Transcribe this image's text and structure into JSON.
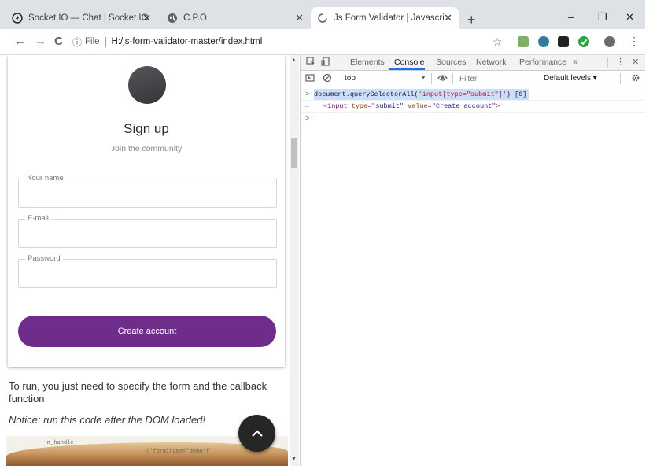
{
  "browser": {
    "tabs": [
      {
        "title": "Socket.IO — Chat | Socket.IO"
      },
      {
        "title": "C.P.O"
      },
      {
        "title": "Js Form Validator | Javascript vali"
      }
    ],
    "new_tab": "+",
    "window_controls": {
      "minimize": "–",
      "restore": "❐",
      "close": "✕"
    },
    "nav": {
      "back": "←",
      "forward": "→",
      "reload": "C"
    },
    "address": {
      "info": "ⓘ",
      "scheme": "File",
      "url": "H:/js-form-validator-master/index.html"
    }
  },
  "page": {
    "card": {
      "title": "Sign up",
      "subtitle": "Join the community",
      "fields": [
        {
          "label": "Your name"
        },
        {
          "label": "E-mail"
        },
        {
          "label": "Password"
        }
      ],
      "button": "Create account"
    },
    "run_text": "To run, you just need to specify the form and the callback function",
    "notice": "Notice: run this code after the DOM loaded!",
    "code_snips": [
      "m_handle",
      "('form[name=\"demo-f"
    ],
    "fab": "⌃"
  },
  "devtools": {
    "tabs": [
      "Elements",
      "Console",
      "Sources",
      "Network",
      "Performance"
    ],
    "active_tab": "Console",
    "more_tabs": "»",
    "context": "top",
    "filter_placeholder": "Filter",
    "levels": "Default levels ▾",
    "console": [
      {
        "type": "input",
        "prompt": ">",
        "parts": [
          "document.querySelectorAll(",
          "'input[type=\"submit\"]'",
          ") [0]"
        ]
      },
      {
        "type": "output",
        "prompt": "←",
        "parts": [
          "<",
          "input",
          " ",
          "type",
          "=\"",
          "submit",
          "\" ",
          "value",
          "=\"",
          "Create account",
          "\">"
        ]
      },
      {
        "type": "prompt",
        "prompt": ">"
      }
    ]
  },
  "colors": {
    "accent": "#6e2c8b",
    "console_tag": "#881280",
    "console_attr_name": "#994500",
    "console_attr_value": "#1a1aa6",
    "console_string": "#c41a16",
    "console_prompt": "#1a73e8",
    "selection": "#c9dffb"
  }
}
